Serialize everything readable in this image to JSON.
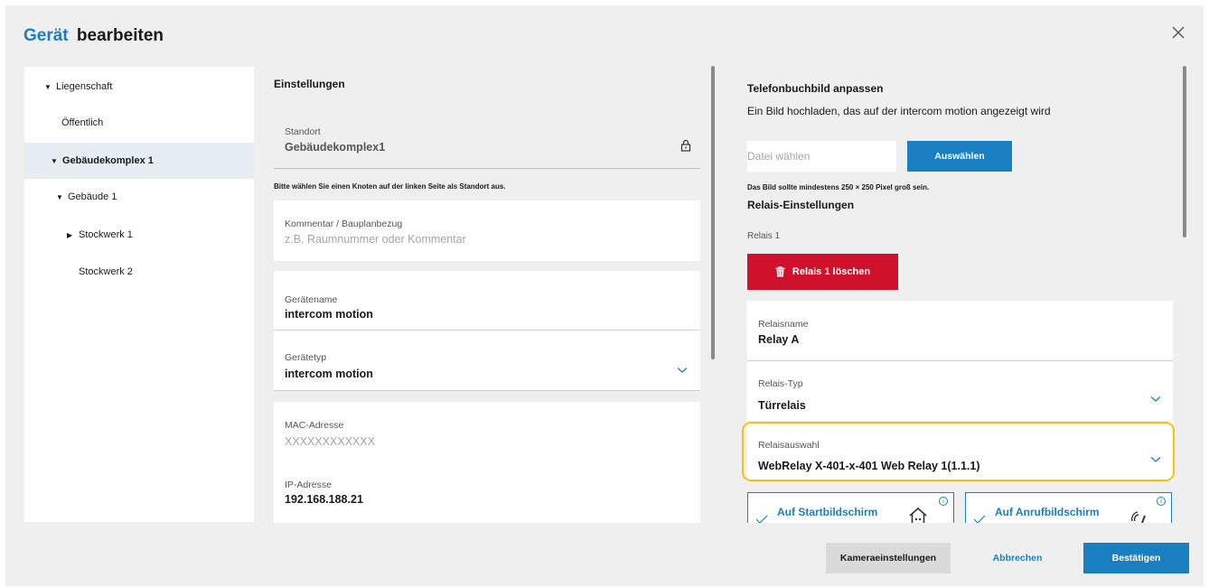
{
  "header": {
    "title_accent": "Gerät",
    "title_rest": "bearbeiten",
    "close_label": "×"
  },
  "tree": {
    "items": [
      {
        "label": "Liegenschaft",
        "caret": "▼"
      },
      {
        "label": "Öffentlich",
        "caret": ""
      },
      {
        "label": "Gebäudekomplex 1",
        "caret": "▼"
      },
      {
        "label": "Gebäude 1",
        "caret": "▼"
      },
      {
        "label": "Stockwerk 1",
        "caret": "▶"
      },
      {
        "label": "Stockwerk 2",
        "caret": ""
      }
    ]
  },
  "settings": {
    "heading": "Einstellungen",
    "location_label": "Standort",
    "location_value": "Gebäudekomplex1",
    "location_note": "Bitte wählen Sie einen Knoten auf der linken Seite als Standort aus.",
    "comment_label": "Kommentar / Bauplanbezug",
    "comment_placeholder": "z.B. Raumnummer oder Kommentar",
    "device_name_label": "Gerätename",
    "device_name_value": "intercom motion",
    "device_type_label": "Gerätetyp",
    "device_type_value": "intercom motion",
    "mac_label": "MAC-Adresse",
    "mac_placeholder": "XXXXXXXXXXXX",
    "ip_label": "IP-Adresse",
    "ip_value": "192.168.188.21"
  },
  "phonebook": {
    "heading": "Telefonbuchbild anpassen",
    "description": "Ein Bild hochladen, das auf der intercom motion angezeigt wird",
    "file_placeholder": "Datei wählen",
    "select_button": "Auswählen",
    "size_note": "Das Bild sollte mindestens 250 × 250 Pixel groß sein."
  },
  "relay": {
    "heading": "Relais-Einstellungen",
    "relay_label": "Relais 1",
    "delete_button": "Relais 1 löschen",
    "name_label": "Relaisname",
    "name_value": "Relay A",
    "type_label": "Relais-Typ",
    "type_value": "Türrelais",
    "selection_label": "Relaisauswahl",
    "selection_value": "WebRelay X-401-x-401 Web Relay 1(1.1.1)",
    "card_start": "Auf Startbildschirm",
    "card_call": "Auf Anrufbildschirm",
    "info_glyph": "i"
  },
  "footer": {
    "camera_button": "Kameraeinstellungen",
    "cancel_button": "Abbrechen",
    "confirm_button": "Bestätigen"
  },
  "colors": {
    "accent": "#1a7fc1",
    "danger": "#d0112b",
    "highlight": "#f2c21b"
  }
}
